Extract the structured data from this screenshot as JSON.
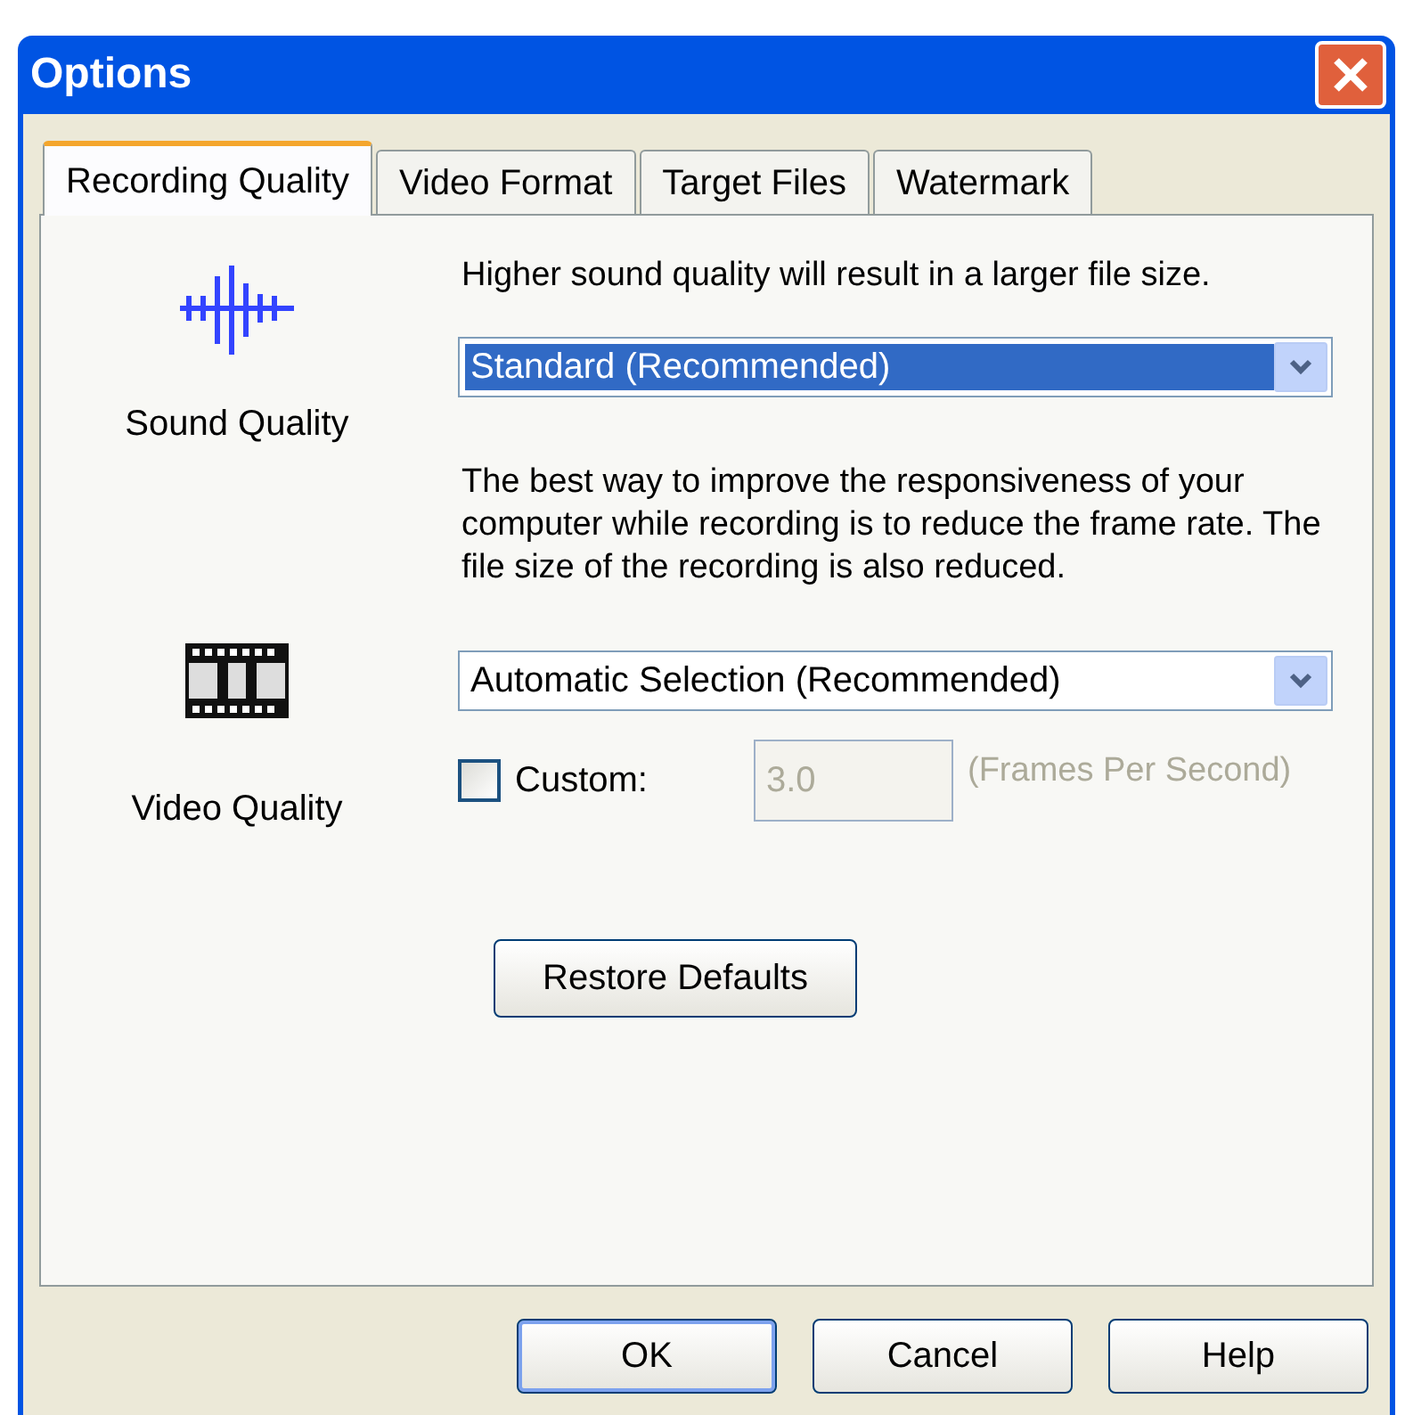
{
  "window": {
    "title": "Options"
  },
  "tabs": [
    {
      "label": "Recording Quality",
      "selected": true
    },
    {
      "label": "Video Format",
      "selected": false
    },
    {
      "label": "Target Files",
      "selected": false
    },
    {
      "label": "Watermark",
      "selected": false
    }
  ],
  "sound": {
    "label": "Sound Quality",
    "hint": "Higher sound quality will result in a larger file size.",
    "dropdown": {
      "value": "Standard (Recommended)",
      "highlighted": true
    }
  },
  "video": {
    "label": "Video Quality",
    "hint": "The best way to improve the responsiveness of your computer while recording is to reduce the frame rate.  The file size of the recording is also reduced.",
    "dropdown": {
      "value": "Automatic Selection (Recommended)",
      "highlighted": false
    }
  },
  "custom": {
    "label": "Custom:",
    "checked": false,
    "value": "3.0",
    "disabled": true,
    "unit": "(Frames Per Second)"
  },
  "restore_button": "Restore Defaults",
  "buttons": [
    {
      "label": "OK",
      "default": true
    },
    {
      "label": "Cancel",
      "default": false
    },
    {
      "label": "Help",
      "default": false
    }
  ]
}
